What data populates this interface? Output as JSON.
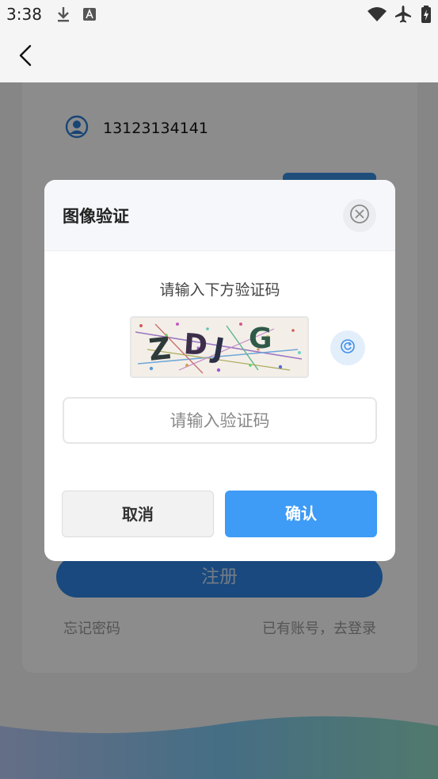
{
  "status_bar": {
    "time": "3:38",
    "icons": [
      "download-icon",
      "app-icon",
      "wifi-icon",
      "airplane-icon",
      "battery-icon"
    ]
  },
  "nav": {
    "back_icon": "chevron-left-icon"
  },
  "form": {
    "user_icon": "user-icon",
    "phone_number": "13123134141",
    "register_label": "注册",
    "forgot_password": "忘记密码",
    "have_account": "已有账号，去登录"
  },
  "dialog": {
    "title": "图像验证",
    "close_icon": "close-circle-icon",
    "hint": "请输入下方验证码",
    "captcha_text": "ZDJG",
    "refresh_icon": "refresh-icon",
    "input_placeholder": "请输入验证码",
    "input_value": "",
    "cancel_label": "取消",
    "confirm_label": "确认"
  },
  "colors": {
    "primary": "#3e9bf6",
    "overlay": "rgba(0,0,0,0.45)",
    "wave_start": "#b6cdf5",
    "wave_end": "#8fdcc8"
  }
}
